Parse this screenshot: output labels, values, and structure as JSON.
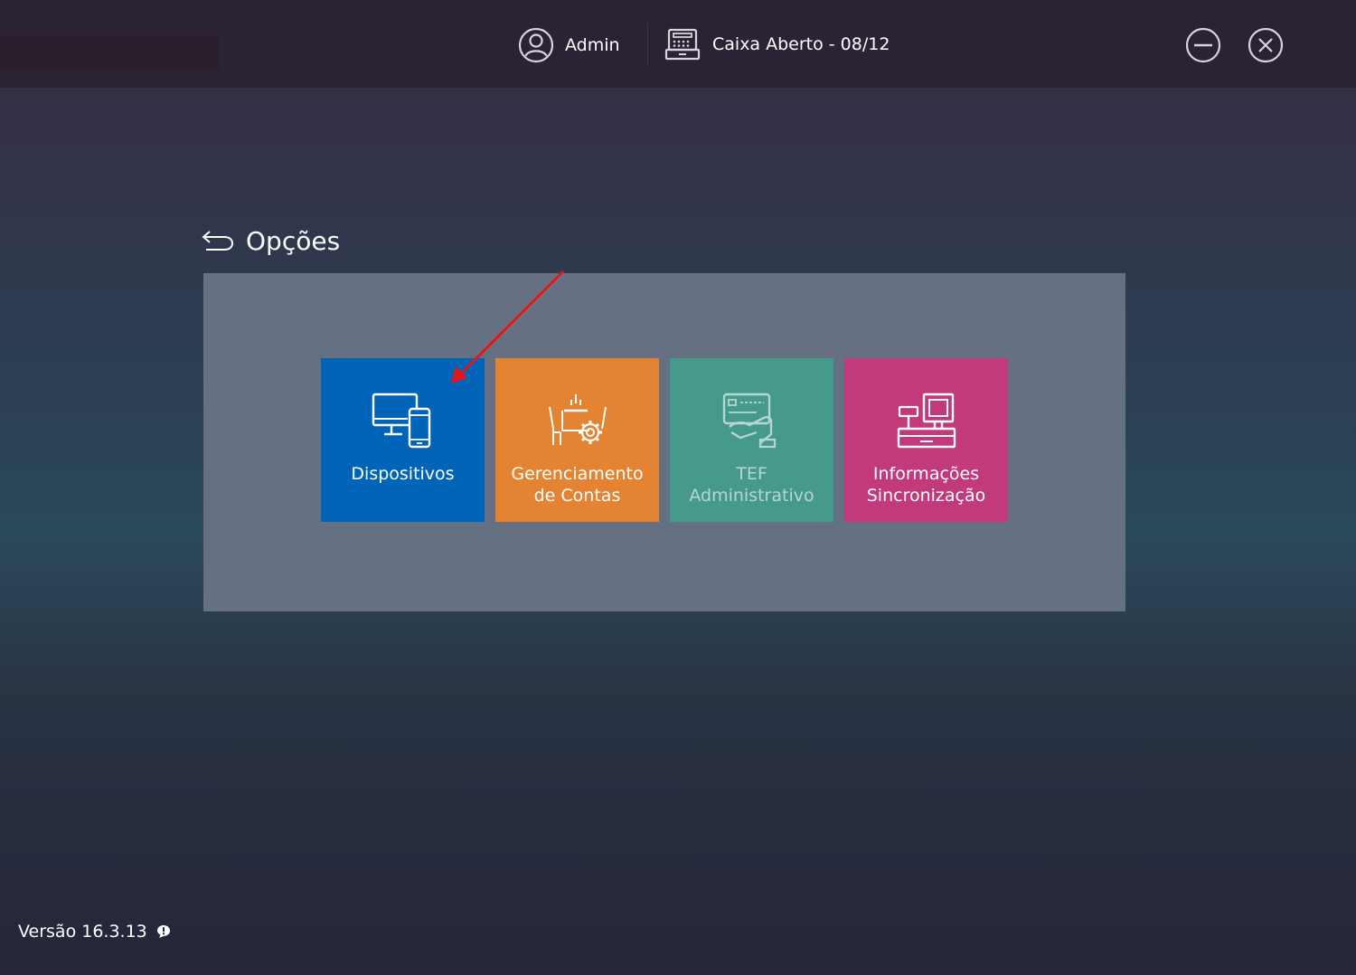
{
  "topbar": {
    "user_label": "Admin",
    "register_status": "Caixa Aberto - 08/12",
    "minimize_icon": "minimize-circle-icon",
    "close_icon": "close-circle-icon"
  },
  "page": {
    "title": "Opções",
    "back_icon": "back-arrow-icon"
  },
  "tiles": [
    {
      "label": "Dispositivos",
      "color": "#0065b8",
      "icon": "devices-icon"
    },
    {
      "label": "Gerenciamento\nde Contas",
      "color": "#e48432",
      "icon": "dining-gear-icon"
    },
    {
      "label": "TEF\nAdministrativo",
      "color": "#469a8b",
      "icon": "card-payment-icon"
    },
    {
      "label": "Informações\nSincronização",
      "color": "#c2397c",
      "icon": "cash-register-icon"
    }
  ],
  "footer": {
    "version": "Versão 16.3.13",
    "info_icon": "info-bubble-icon"
  },
  "colors": {
    "panel": "#657083",
    "topbar": "#2b2233",
    "annotation_arrow": "#e8141b"
  }
}
